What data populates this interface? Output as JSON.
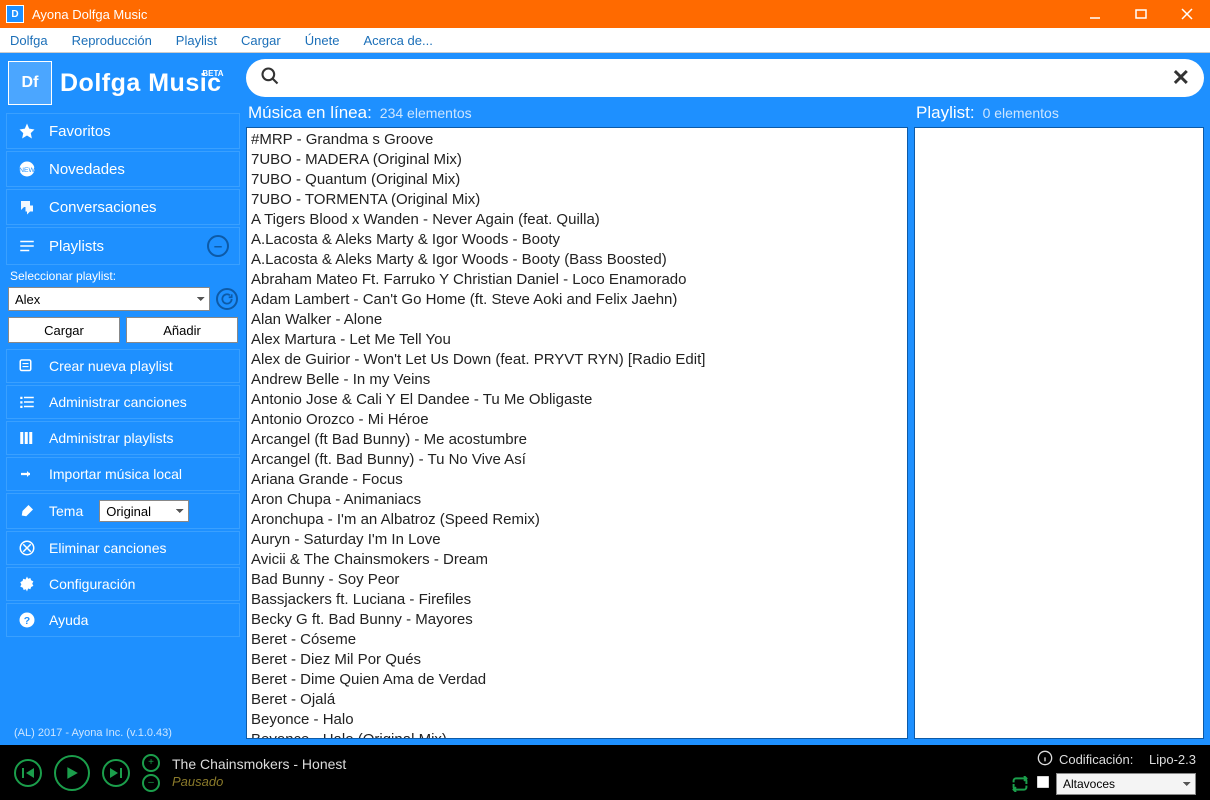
{
  "window": {
    "title": "Ayona Dolfga Music"
  },
  "menu": [
    "Dolfga",
    "Reproducción",
    "Playlist",
    "Cargar",
    "Únete",
    "Acerca de..."
  ],
  "brand": {
    "logo": "Df",
    "name": "Dolfga Music",
    "beta": "BETA"
  },
  "sidebar": {
    "items": [
      {
        "label": "Favoritos",
        "icon": "star"
      },
      {
        "label": "Novedades",
        "icon": "new"
      },
      {
        "label": "Conversaciones",
        "icon": "chat"
      },
      {
        "label": "Playlists",
        "icon": "list",
        "has_minus": true
      }
    ],
    "select_label": "Seleccionar playlist:",
    "select_value": "Alex",
    "btn_cargar": "Cargar",
    "btn_anadir": "Añadir",
    "actions": [
      {
        "label": "Crear nueva playlist",
        "icon": "create"
      },
      {
        "label": "Administrar canciones",
        "icon": "songs"
      },
      {
        "label": "Administrar playlists",
        "icon": "playlists"
      },
      {
        "label": "Importar música local",
        "icon": "import"
      }
    ],
    "tema_label": "Tema",
    "tema_value": "Original",
    "actions2": [
      {
        "label": "Eliminar canciones",
        "icon": "delete"
      },
      {
        "label": "Configuración",
        "icon": "gear"
      },
      {
        "label": "Ayuda",
        "icon": "help"
      }
    ],
    "footer": "(AL) 2017 - Ayona Inc. (v.1.0.43)"
  },
  "search": {
    "placeholder": ""
  },
  "online": {
    "title": "Música en línea:",
    "count": "234 elementos",
    "songs": [
      "#MRP - Grandma s Groove",
      "7UBO - MADERA (Original Mix)",
      "7UBO - Quantum (Original Mix)",
      "7UBO - TORMENTA (Original Mix)",
      "A Tigers Blood x Wanden - Never Again (feat. Quilla)",
      "A.Lacosta & Aleks Marty & Igor Woods - Booty",
      "A.Lacosta & Aleks Marty & Igor Woods - Booty (Bass Boosted)",
      "Abraham Mateo Ft. Farruko Y Christian Daniel - Loco Enamorado",
      "Adam Lambert - Can't Go Home (ft. Steve Aoki and Felix Jaehn)",
      "Alan Walker - Alone",
      "Alex Martura - Let Me Tell You",
      "Alex de Guirior - Won't Let Us Down (feat. PRYVT RYN) [Radio Edit]",
      "Andrew Belle - In my Veins",
      "Antonio Jose & Cali Y El Dandee - Tu Me Obligaste",
      "Antonio Orozco - Mi Héroe",
      "Arcangel (ft Bad Bunny) - Me acostumbre",
      "Arcangel (ft. Bad Bunny) - Tu No Vive Así",
      "Ariana Grande - Focus",
      "Aron Chupa - Animaniacs",
      "Aronchupa - I'm an Albatroz (Speed Remix)",
      "Auryn - Saturday I'm In Love",
      "Avicii & The Chainsmokers - Dream",
      "Bad Bunny - Soy Peor",
      "Bassjackers ft. Luciana - Firefiles",
      "Becky G ft. Bad Bunny - Mayores",
      "Beret - Cóseme",
      "Beret - Diez Mil Por Qués",
      "Beret - Dime Quien Ama de Verdad",
      "Beret - Ojalá",
      "Beyonce - Halo",
      "Beyonce - Halo (Original Mix)"
    ]
  },
  "playlist": {
    "title": "Playlist:",
    "count": "0 elementos"
  },
  "player": {
    "now_playing": "The Chainsmokers - Honest",
    "status": "Pausado",
    "codif_label": "Codificación:",
    "codif_value": "Lipo-2.3",
    "output": "Altavoces"
  }
}
